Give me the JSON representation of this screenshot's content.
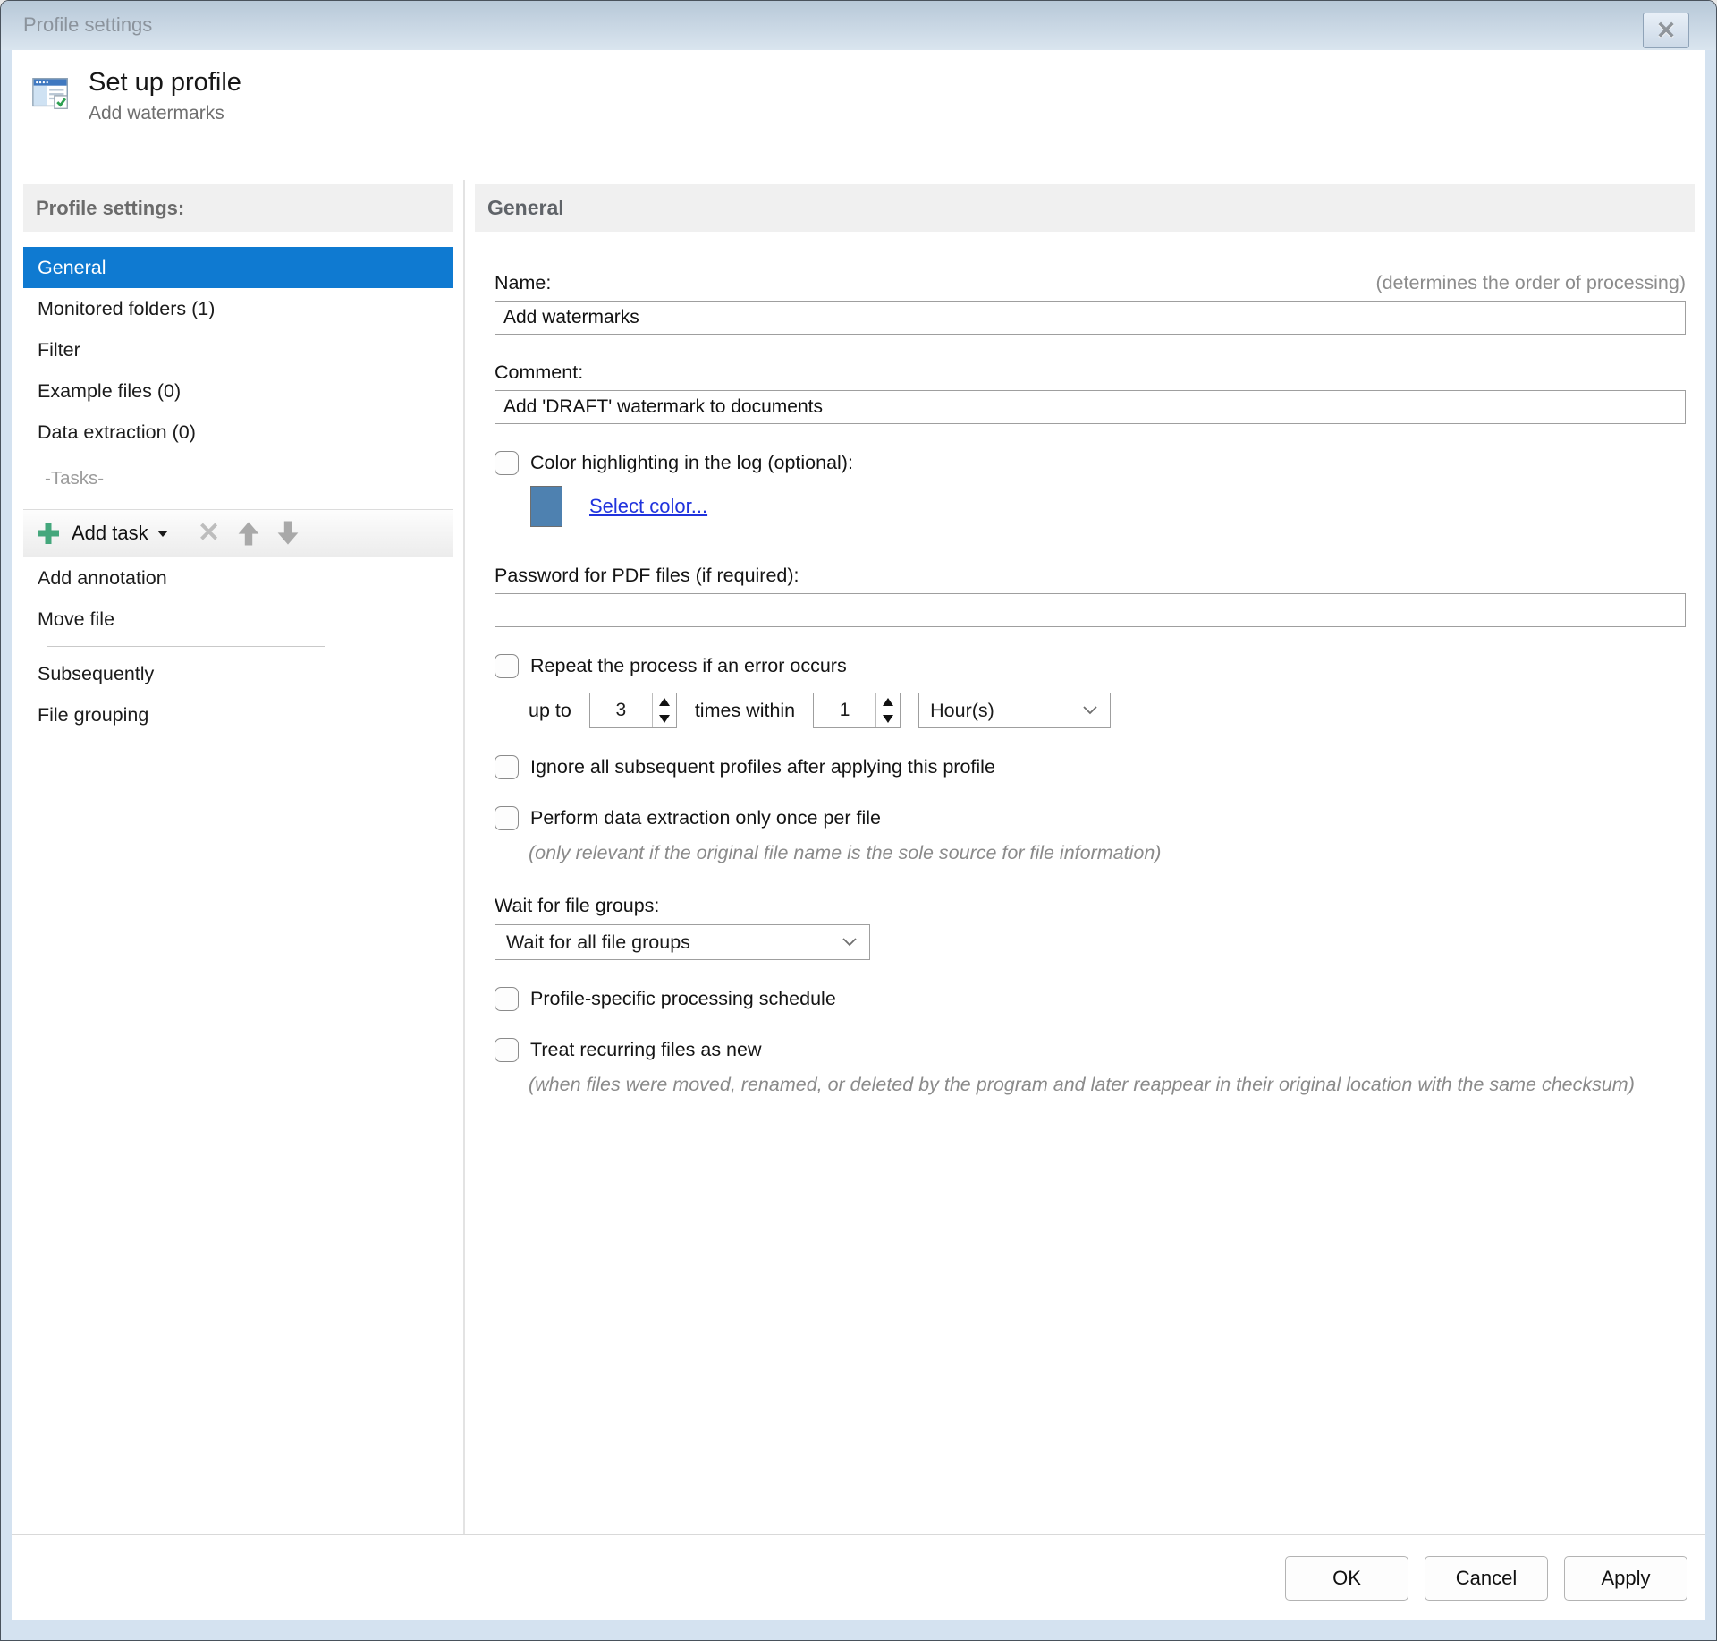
{
  "window": {
    "title": "Profile settings",
    "icons": {
      "close": "✕",
      "delete": "✕"
    }
  },
  "header": {
    "title": "Set up profile",
    "subtitle": "Add watermarks"
  },
  "sidebar": {
    "header": "Profile settings:",
    "items": [
      {
        "label": "General",
        "selected": true
      },
      {
        "label": "Monitored folders (1)",
        "selected": false
      },
      {
        "label": "Filter",
        "selected": false
      },
      {
        "label": "Example files (0)",
        "selected": false
      },
      {
        "label": "Data extraction (0)",
        "selected": false
      }
    ],
    "tasks_caption": "-Tasks-",
    "toolbar": {
      "add_task_label": "Add task"
    },
    "task_items": [
      {
        "label": "Add annotation"
      },
      {
        "label": "Move file"
      }
    ],
    "bottom_items": [
      {
        "label": "Subsequently"
      },
      {
        "label": "File grouping"
      }
    ]
  },
  "main": {
    "section_title": "General",
    "name": {
      "label": "Name:",
      "hint": "(determines the order of processing)",
      "value": "Add watermarks"
    },
    "comment": {
      "label": "Comment:",
      "value": "Add 'DRAFT' watermark to documents"
    },
    "color_highlighting": {
      "label": "Color highlighting in the log (optional):",
      "checked": false,
      "swatch_color": "#4E81B0",
      "link": "Select color..."
    },
    "password": {
      "label": "Password for PDF files (if required):",
      "value": ""
    },
    "repeat": {
      "label": "Repeat the process if an error occurs",
      "checked": false,
      "prefix": "up to",
      "times_value": "3",
      "middle": "times within",
      "within_value": "1",
      "unit_value": "Hour(s)"
    },
    "ignore_subsequent": {
      "label": "Ignore all subsequent profiles after applying this profile",
      "checked": false
    },
    "extract_once": {
      "label": "Perform data extraction only once per file",
      "checked": false,
      "note": "(only relevant if the original file name is the sole source for file information)"
    },
    "wait_groups": {
      "label": "Wait for file groups:",
      "value": "Wait for all file groups"
    },
    "schedule": {
      "label": "Profile-specific processing schedule",
      "checked": false
    },
    "recurring": {
      "label": "Treat recurring files as new",
      "checked": false,
      "note": "(when files were moved, renamed, or deleted by the program and later reappear in their original location with the same checksum)"
    }
  },
  "footer": {
    "ok": "OK",
    "cancel": "Cancel",
    "apply": "Apply"
  },
  "colors": {
    "selection_accent": "#0F7AD1",
    "link_blue": "#2033DD",
    "swatch_blue": "#4E81B0",
    "toolbar_plus_green": "#44A77C",
    "titlebar_gradient_top": "#B7C8D8",
    "titlebar_gradient_bottom": "#DAE5EF"
  }
}
